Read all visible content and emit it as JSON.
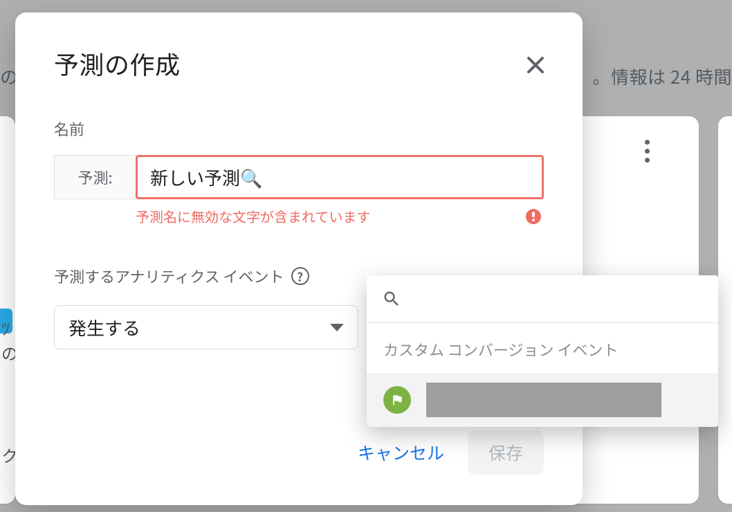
{
  "background": {
    "partial_left": "の",
    "partial_right": "。情報は 24 時間",
    "crumb1": "ﾂ",
    "crumb2": "の",
    "crumb3": "ク"
  },
  "modal": {
    "title": "予測の作成",
    "name_label": "名前",
    "name_prefix": "予測:",
    "name_value": "新しい予測🔍",
    "name_error": "予測名に無効な文字が含まれています",
    "event_label": "予測するアナリティクス イベント",
    "select_value": "発生する",
    "cancel": "キャンセル",
    "save": "保存"
  },
  "popover": {
    "search_placeholder": "",
    "section_header": "カスタム コンバージョン イベント"
  }
}
